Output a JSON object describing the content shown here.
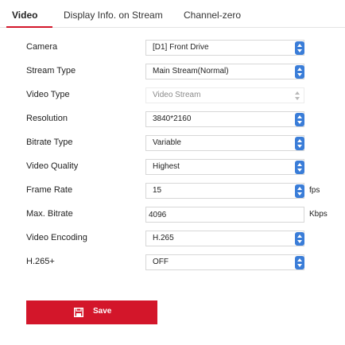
{
  "tabs": [
    {
      "label": "Video"
    },
    {
      "label": "Display Info. on Stream"
    },
    {
      "label": "Channel-zero"
    }
  ],
  "form": {
    "camera": {
      "label": "Camera",
      "value": "[D1] Front Drive"
    },
    "stream_type": {
      "label": "Stream Type",
      "value": "Main Stream(Normal)"
    },
    "video_type": {
      "label": "Video Type",
      "value": "Video Stream"
    },
    "resolution": {
      "label": "Resolution",
      "value": "3840*2160"
    },
    "bitrate_type": {
      "label": "Bitrate Type",
      "value": "Variable"
    },
    "video_quality": {
      "label": "Video Quality",
      "value": "Highest"
    },
    "frame_rate": {
      "label": "Frame Rate",
      "value": "15",
      "unit": "fps"
    },
    "max_bitrate": {
      "label": "Max. Bitrate",
      "value": "4096",
      "unit": "Kbps"
    },
    "video_encoding": {
      "label": "Video Encoding",
      "value": "H.265"
    },
    "h265plus": {
      "label": "H.265+",
      "value": "OFF"
    }
  },
  "save_button": {
    "label": "Save",
    "icon": "save-icon"
  },
  "colors": {
    "accent": "#d3162a",
    "dropdown_caret": "#3a7dd8"
  }
}
